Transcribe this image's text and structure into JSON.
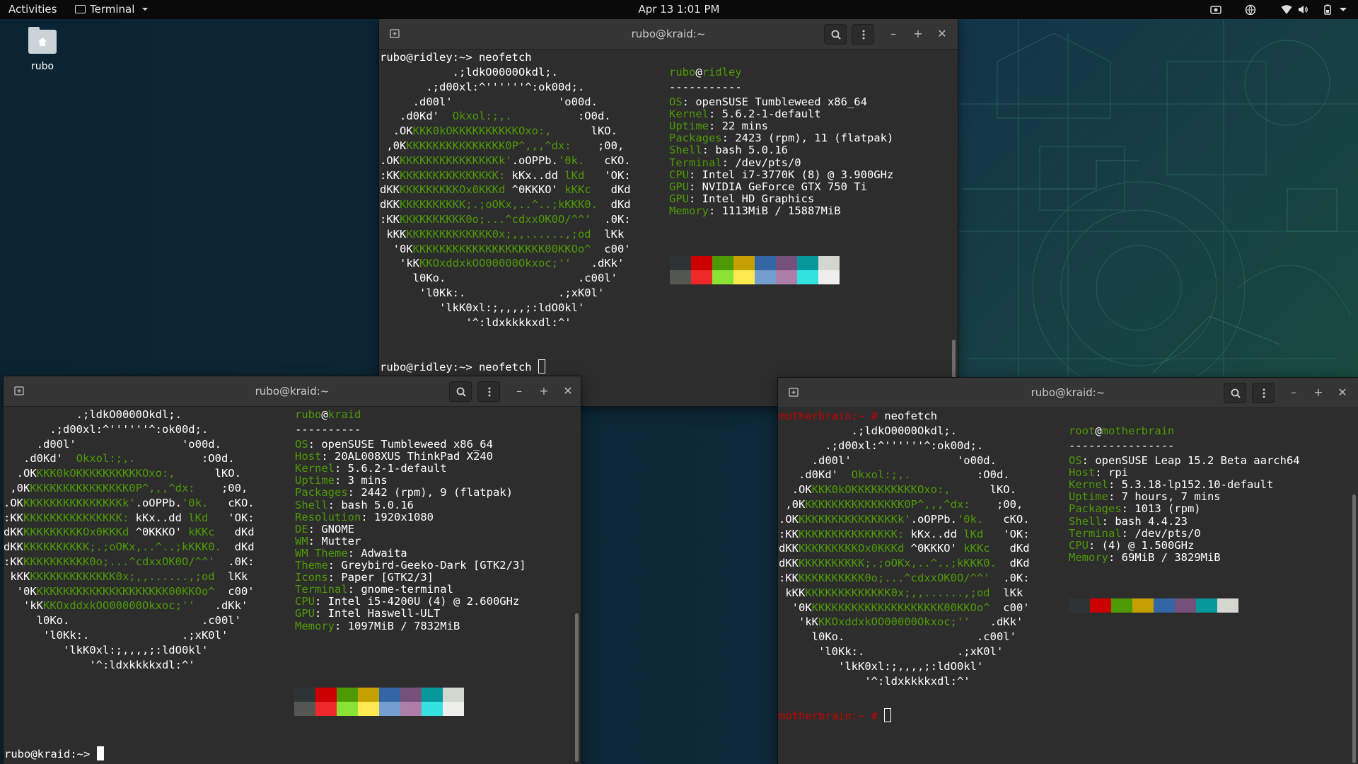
{
  "topbar": {
    "activities": "Activities",
    "app_name": "Terminal",
    "clock": "Apr 13  1:01 PM"
  },
  "desktop": {
    "home_icon_label": "rubo"
  },
  "palette": {
    "row1": [
      "#2e3436",
      "#cc0000",
      "#4e9a06",
      "#c4a000",
      "#3465a4",
      "#75507b",
      "#06989a",
      "#d3d7cf"
    ],
    "row2": [
      "#555753",
      "#ef2929",
      "#8ae234",
      "#fce94f",
      "#729fcf",
      "#ad7fa8",
      "#34e2e2",
      "#eeeeec"
    ]
  },
  "colors": {
    "user_green": "#4e9a06",
    "root_prompt_red": "#cc0000",
    "terminal_bg": "#2d2d2d"
  },
  "win1": {
    "title": "rubo@kraid:~",
    "cmd_line": "rubo@ridley:~> neofetch",
    "prompt": "rubo@ridley:~> neofetch ",
    "user": "rubo",
    "host": "ridley",
    "sep": "-----------",
    "info": [
      {
        "k": "OS",
        "v": "openSUSE Tumbleweed x86_64"
      },
      {
        "k": "Kernel",
        "v": "5.6.2-1-default"
      },
      {
        "k": "Uptime",
        "v": "22 mins"
      },
      {
        "k": "Packages",
        "v": "2423 (rpm), 11 (flatpak)"
      },
      {
        "k": "Shell",
        "v": "bash 5.0.16"
      },
      {
        "k": "Terminal",
        "v": "/dev/pts/0"
      },
      {
        "k": "CPU",
        "v": "Intel i7-3770K (8) @ 3.900GHz"
      },
      {
        "k": "GPU",
        "v": "NVIDIA GeForce GTX 750 Ti"
      },
      {
        "k": "GPU",
        "v": "Intel HD Graphics"
      },
      {
        "k": "Memory",
        "v": "1113MiB / 15887MiB"
      }
    ]
  },
  "win2": {
    "title": "rubo@kraid:~",
    "prompt": "rubo@kraid:~> ",
    "user": "rubo",
    "host": "kraid",
    "sep": "----------",
    "info": [
      {
        "k": "OS",
        "v": "openSUSE Tumbleweed x86_64"
      },
      {
        "k": "Host",
        "v": "20AL008XUS ThinkPad X240"
      },
      {
        "k": "Kernel",
        "v": "5.6.2-1-default"
      },
      {
        "k": "Uptime",
        "v": "3 mins"
      },
      {
        "k": "Packages",
        "v": "2442 (rpm), 9 (flatpak)"
      },
      {
        "k": "Shell",
        "v": "bash 5.0.16"
      },
      {
        "k": "Resolution",
        "v": "1920x1080"
      },
      {
        "k": "DE",
        "v": "GNOME"
      },
      {
        "k": "WM",
        "v": "Mutter"
      },
      {
        "k": "WM Theme",
        "v": "Adwaita"
      },
      {
        "k": "Theme",
        "v": "Greybird-Geeko-Dark [GTK2/3]"
      },
      {
        "k": "Icons",
        "v": "Paper [GTK2/3]"
      },
      {
        "k": "Terminal",
        "v": "gnome-terminal"
      },
      {
        "k": "CPU",
        "v": "Intel i5-4200U (4) @ 2.600GHz"
      },
      {
        "k": "GPU",
        "v": "Intel Haswell-ULT"
      },
      {
        "k": "Memory",
        "v": "1097MiB / 7832MiB"
      }
    ]
  },
  "win3": {
    "title": "rubo@kraid:~",
    "cmd_prompt": "motherbrain:~ #",
    "cmd": " neofetch",
    "user": "root",
    "host": "motherbrain",
    "sep": "----------------",
    "info": [
      {
        "k": "OS",
        "v": "openSUSE Leap 15.2 Beta aarch64"
      },
      {
        "k": "Host",
        "v": "rpi"
      },
      {
        "k": "Kernel",
        "v": "5.3.18-lp152.10-default"
      },
      {
        "k": "Uptime",
        "v": "7 hours, 7 mins"
      },
      {
        "k": "Packages",
        "v": "1013 (rpm)"
      },
      {
        "k": "Shell",
        "v": "bash 4.4.23"
      },
      {
        "k": "Terminal",
        "v": "/dev/pts/0"
      },
      {
        "k": "CPU",
        "v": "(4) @ 1.500GHz"
      },
      {
        "k": "Memory",
        "v": "69MiB / 3829MiB"
      }
    ]
  },
  "logo": [
    [
      [
        "w",
        "           .;ldkO0000Okdl;."
      ]
    ],
    [
      [
        "w",
        "       .;d00xl:^''''''^:ok00d;."
      ]
    ],
    [
      [
        "w",
        "     .d00l'                'o00d."
      ]
    ],
    [
      [
        "w",
        "   .d0Kd'  "
      ],
      [
        "g",
        "Okxol:;,."
      ],
      [
        "w",
        "          :O0d."
      ]
    ],
    [
      [
        "w",
        "  .OK"
      ],
      [
        "g",
        "KKK0kOKKKKKKKKKKOxo:,"
      ],
      [
        "w",
        "      lKO."
      ]
    ],
    [
      [
        "w",
        " ,0K"
      ],
      [
        "g",
        "KKKKKKKKKKKKKKK0P^,,,^dx:"
      ],
      [
        "w",
        "    ;00,"
      ]
    ],
    [
      [
        "w",
        ".OK"
      ],
      [
        "g",
        "KKKKKKKKKKKKKKKk'"
      ],
      [
        "w",
        ".oOPPb."
      ],
      [
        "g",
        "'0k."
      ],
      [
        "w",
        "   cKO."
      ]
    ],
    [
      [
        "w",
        ":KK"
      ],
      [
        "g",
        "KKKKKKKKKKKKKKK: "
      ],
      [
        "w",
        "kKx..dd "
      ],
      [
        "g",
        "lKd"
      ],
      [
        "w",
        "   'OK:"
      ]
    ],
    [
      [
        "w",
        "dKK"
      ],
      [
        "g",
        "KKKKKKKKKOx0KKKd "
      ],
      [
        "w",
        "^0KKKO' "
      ],
      [
        "g",
        "kKKc"
      ],
      [
        "w",
        "   dKd"
      ]
    ],
    [
      [
        "w",
        "dKK"
      ],
      [
        "g",
        "KKKKKKKKKK;.;oOKx,..^..;kKKK0."
      ],
      [
        "w",
        "  dKd"
      ]
    ],
    [
      [
        "w",
        ":KK"
      ],
      [
        "g",
        "KKKKKKKKKK0o;...^cdxxOK0O/^^'"
      ],
      [
        "w",
        "  .0K:"
      ]
    ],
    [
      [
        "w",
        " kKK"
      ],
      [
        "g",
        "KKKKKKKKKKKKK0x;,,......,;od"
      ],
      [
        "w",
        "  lKk"
      ]
    ],
    [
      [
        "w",
        "  '0K"
      ],
      [
        "g",
        "KKKKKKKKKKKKKKKKKKKK00KKOo^"
      ],
      [
        "w",
        "  c00'"
      ]
    ],
    [
      [
        "w",
        "   'kK"
      ],
      [
        "g",
        "KKOxddxkOO00000Okxoc;''"
      ],
      [
        "w",
        "   .dKk'"
      ]
    ],
    [
      [
        "w",
        "     l0Ko.                    .c00l'"
      ]
    ],
    [
      [
        "w",
        "      'l0Kk:.              .;xK0l'"
      ]
    ],
    [
      [
        "w",
        "         'lkK0xl:;,,,,;:ldO0kl'"
      ]
    ],
    [
      [
        "w",
        "             '^:ldxkkkkxdl:^'"
      ]
    ]
  ]
}
